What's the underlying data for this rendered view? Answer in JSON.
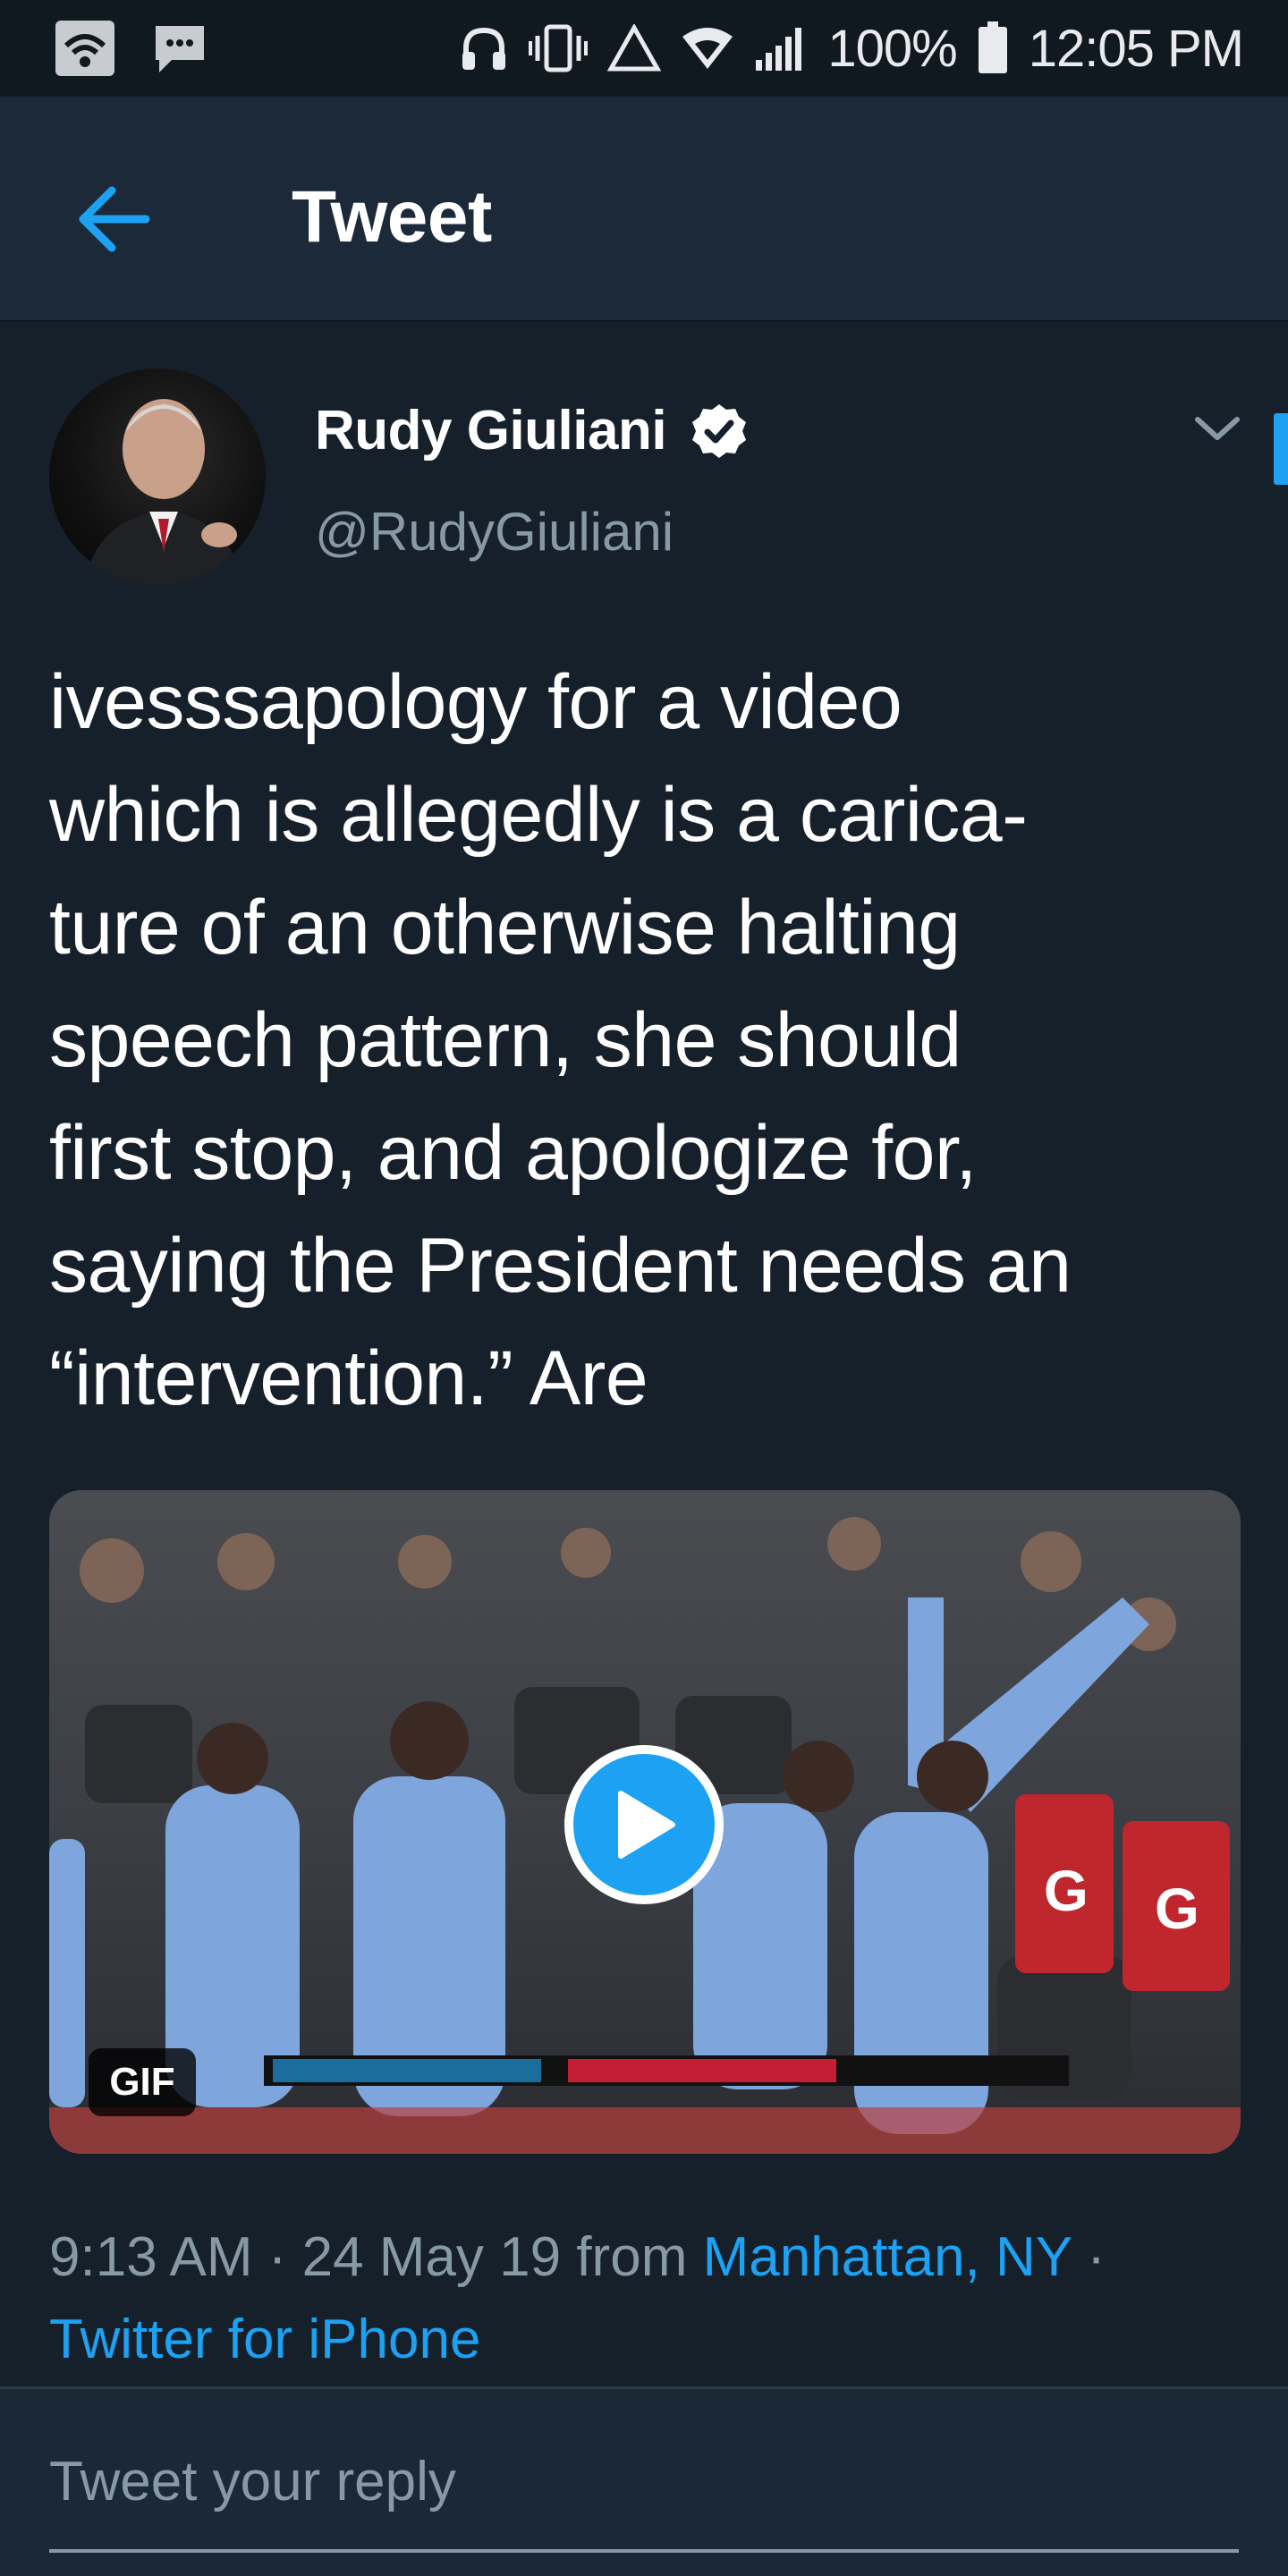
{
  "status_bar": {
    "battery": "100%",
    "time": "12:05 PM",
    "icons": [
      "wifi-box-icon",
      "chat-bubble-icon",
      "headphones-icon",
      "vibrate-icon",
      "warning-triangle-icon",
      "wifi-icon",
      "signal-bars-icon",
      "battery-icon"
    ]
  },
  "header": {
    "title": "Tweet",
    "back_icon": "back-arrow-icon"
  },
  "tweet": {
    "author_name": "Rudy Giuliani",
    "author_handle": "@RudyGiuliani",
    "verified": true,
    "text": "ivesssapology for a video\nwhich is allegedly is a carica-\nture of an otherwise halting\nspeech pattern, she should\nfirst stop, and apologize for,\nsaying the President needs an\n“intervention.” Are",
    "media": {
      "badge": "GIF",
      "play_icon": "play-icon"
    },
    "meta": {
      "time": "9:13 AM",
      "separator": " · ",
      "date": "24 May 19",
      "from": " from ",
      "location": "Manhattan, NY",
      "separator2": " ·",
      "source": "Twitter for iPhone"
    }
  },
  "reply": {
    "placeholder": "Tweet your reply"
  },
  "colors": {
    "background": "#15202b",
    "header": "#1c2938",
    "accent": "#1da1f2",
    "secondary_text": "#8899a6"
  }
}
